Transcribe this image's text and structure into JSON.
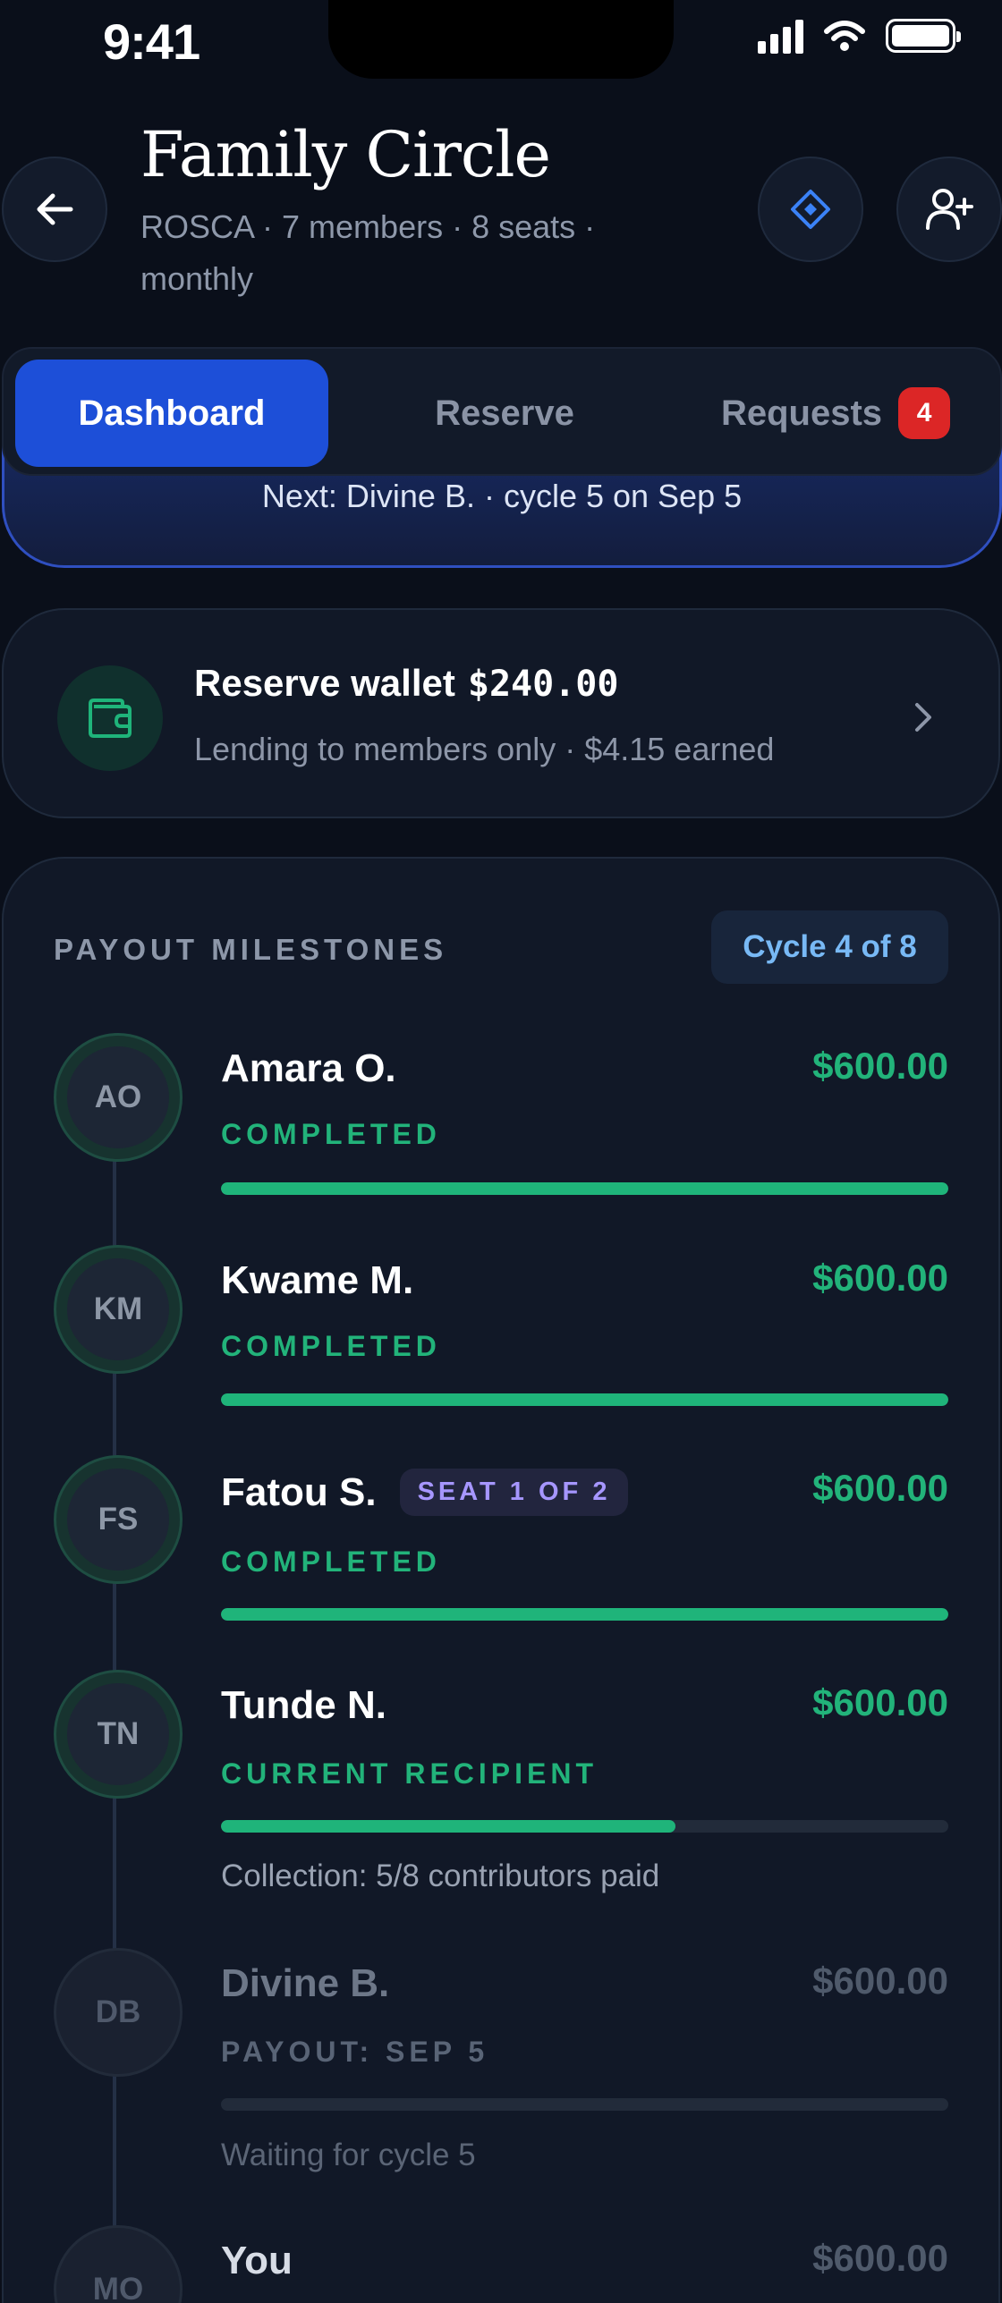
{
  "status_bar": {
    "time": "9:41"
  },
  "header": {
    "title": "Family Circle",
    "subtitle": "ROSCA · 7 members · 8 seats · monthly"
  },
  "tabs": [
    {
      "label": "Dashboard",
      "active": true
    },
    {
      "label": "Reserve",
      "active": false
    },
    {
      "label": "Requests",
      "active": false,
      "badge": "4"
    }
  ],
  "hero": {
    "next_text": "Next: Divine B. · cycle 5 on Sep 5"
  },
  "wallet": {
    "title": "Reserve wallet",
    "amount": "$240.00",
    "subtitle": "Lending to members only · $4.15 earned"
  },
  "milestones": {
    "section_label": "PAYOUT MILESTONES",
    "cycle_label": "Cycle 4 of 8",
    "items": [
      {
        "initials": "AO",
        "name": "Amara O.",
        "amount": "$600.00",
        "status": "COMPLETED",
        "progress": 1.0
      },
      {
        "initials": "KM",
        "name": "Kwame M.",
        "amount": "$600.00",
        "status": "COMPLETED",
        "progress": 1.0
      },
      {
        "initials": "FS",
        "name": "Fatou S.",
        "seat": "SEAT 1 OF 2",
        "amount": "$600.00",
        "status": "COMPLETED",
        "progress": 1.0
      },
      {
        "initials": "TN",
        "name": "Tunde N.",
        "amount": "$600.00",
        "status": "CURRENT RECIPIENT",
        "progress": 0.625,
        "note": "Collection: 5/8 contributors paid"
      },
      {
        "initials": "DB",
        "name": "Divine B.",
        "amount": "$600.00",
        "status": "PAYOUT: SEP 5",
        "progress": 0,
        "note": "Waiting for cycle 5"
      },
      {
        "initials": "MO",
        "name": "You",
        "amount": "$600.00"
      }
    ]
  },
  "colors": {
    "accent_blue": "#1d4fd8",
    "success_green": "#22b37a",
    "badge_red": "#dc2626",
    "seat_purple": "#a696ff"
  }
}
